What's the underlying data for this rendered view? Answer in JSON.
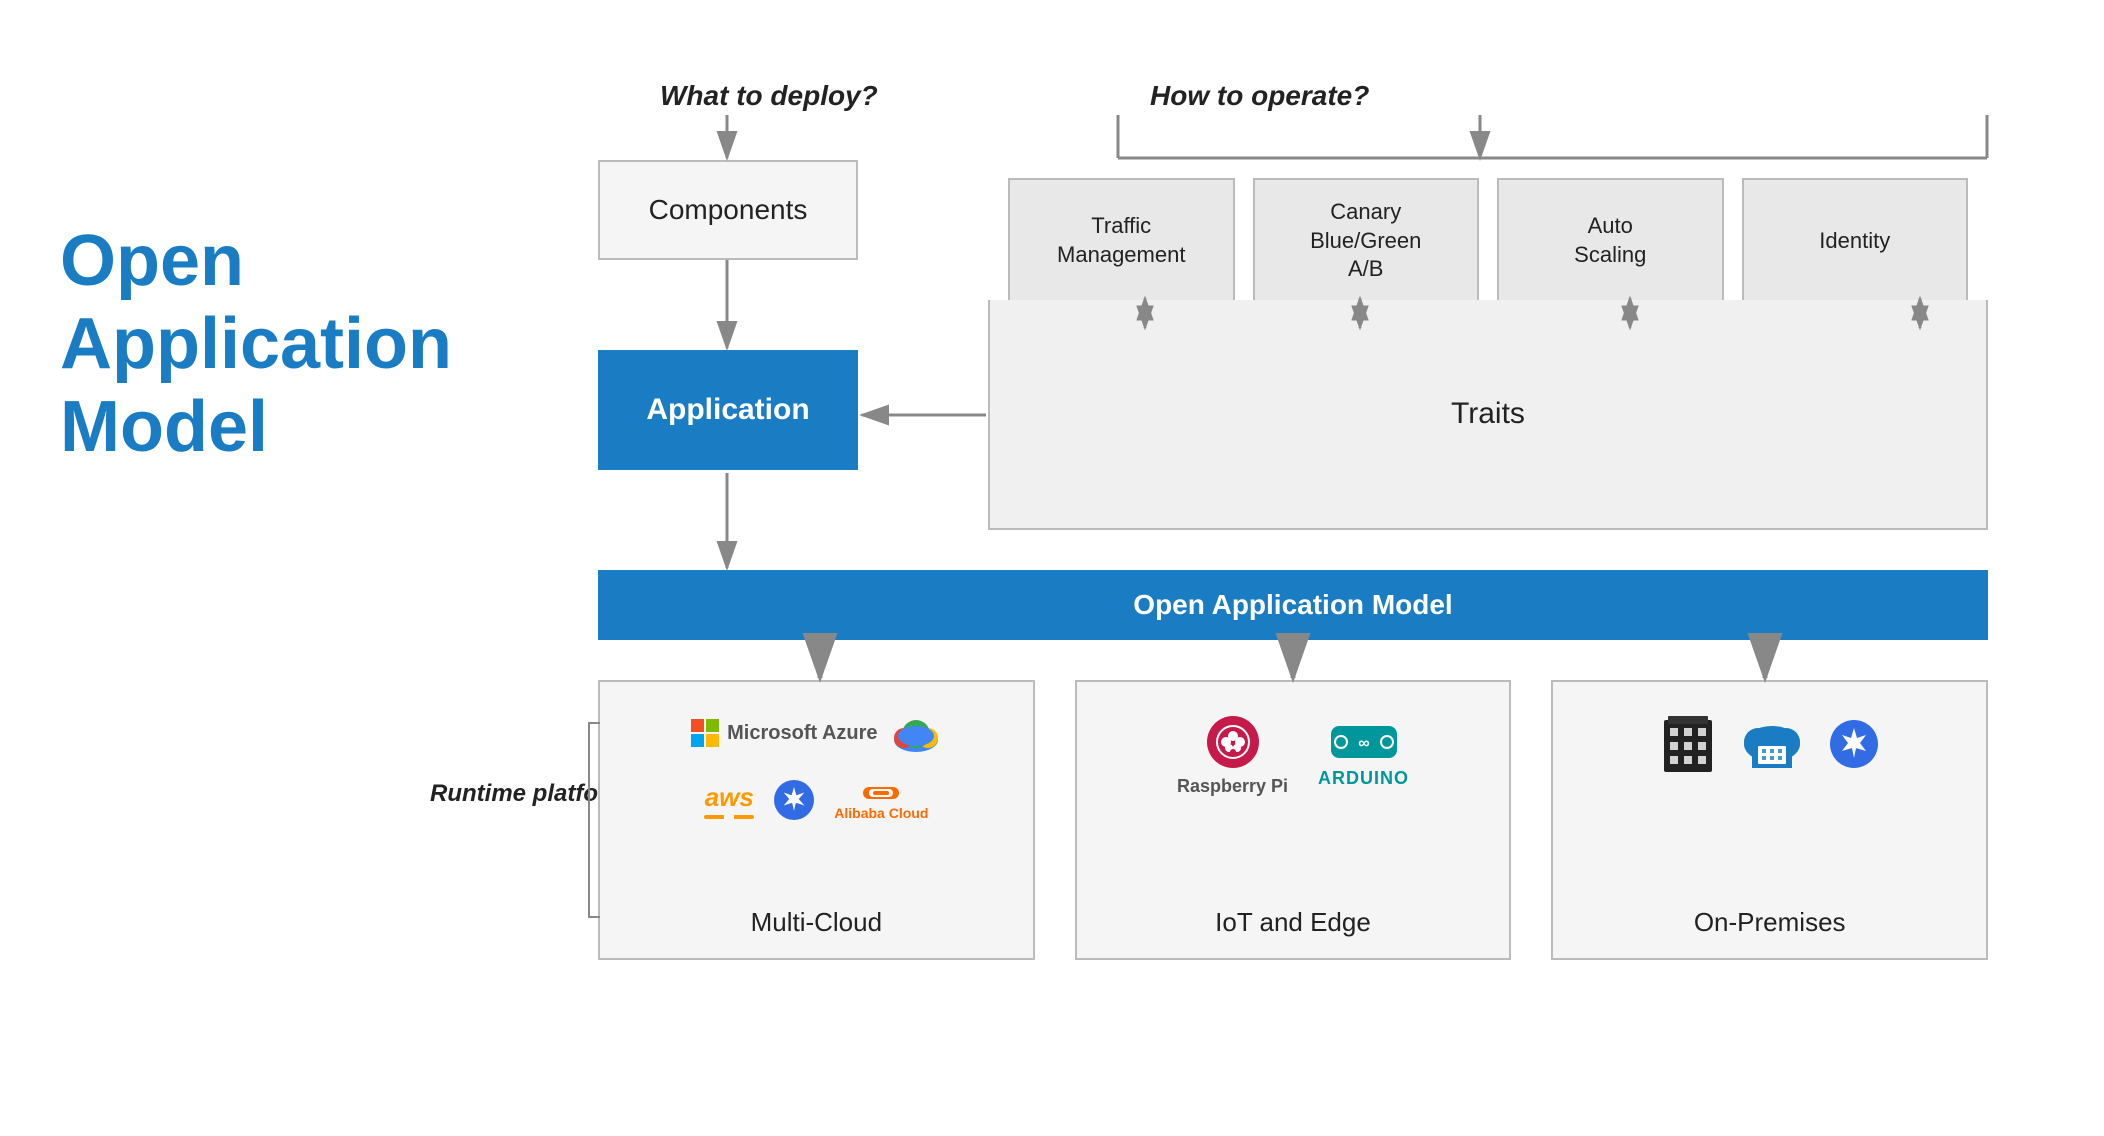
{
  "title": {
    "line1": "Open",
    "line2": "Application",
    "line3": "Model"
  },
  "labels": {
    "what_to_deploy": "What to deploy?",
    "how_to_operate": "How to operate?",
    "runtime_platforms": "Runtime platforms"
  },
  "boxes": {
    "components": "Components",
    "application": "Application",
    "traits": "Traits",
    "oam": "Open Application Model"
  },
  "traits": [
    "Traffic\nManagement",
    "Canary\nBlue/Green\nA/B",
    "Auto\nScaling",
    "Identity"
  ],
  "platforms": [
    {
      "name": "Multi-Cloud",
      "icons": [
        "microsoft-azure",
        "gcp",
        "aws",
        "kubernetes",
        "alibaba-cloud"
      ]
    },
    {
      "name": "IoT and Edge",
      "icons": [
        "raspberry-pi",
        "arduino"
      ]
    },
    {
      "name": "On-Premises",
      "icons": [
        "building",
        "cloud-building",
        "kubernetes"
      ]
    }
  ]
}
